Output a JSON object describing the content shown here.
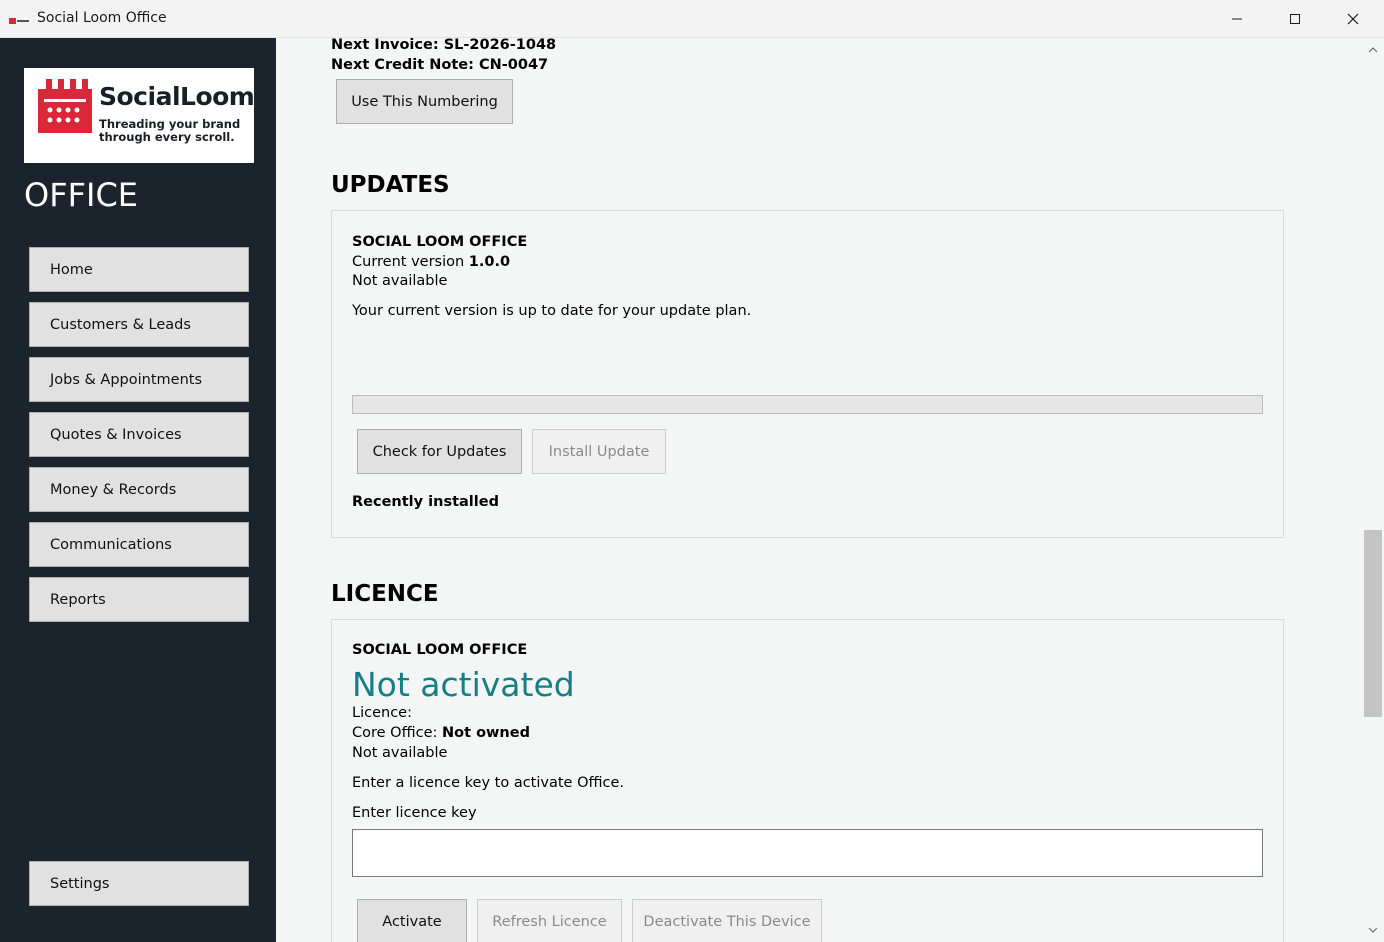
{
  "window": {
    "title": "Social Loom Office"
  },
  "sidebar": {
    "logo": {
      "name": "SocialLoom",
      "tagline": "Threading your brand through every scroll."
    },
    "section_label": "OFFICE",
    "nav": [
      {
        "label": "Home"
      },
      {
        "label": "Customers & Leads"
      },
      {
        "label": "Jobs & Appointments"
      },
      {
        "label": "Quotes & Invoices"
      },
      {
        "label": "Money & Records"
      },
      {
        "label": "Communications"
      },
      {
        "label": "Reports"
      }
    ],
    "settings_label": "Settings"
  },
  "numbering": {
    "next_invoice_label": "Next Invoice:",
    "next_invoice_value": "SL-2026-1048",
    "next_credit_label": "Next Credit Note:",
    "next_credit_value": "CN-0047",
    "use_button": "Use This Numbering"
  },
  "updates": {
    "heading": "UPDATES",
    "product": "SOCIAL LOOM OFFICE",
    "current_version_label": "Current version",
    "current_version_value": "1.0.0",
    "availability": "Not available",
    "message": "Your current version is up to date for your update plan.",
    "progress": 0,
    "check_button": "Check for Updates",
    "install_button": "Install Update",
    "recent_heading": "Recently installed"
  },
  "licence": {
    "heading": "LICENCE",
    "product": "SOCIAL LOOM OFFICE",
    "status": "Not activated",
    "licence_label": "Licence:",
    "core_label": "Core Office:",
    "core_value": "Not owned",
    "availability": "Not available",
    "instruction": "Enter a licence key to activate Office.",
    "key_label": "Enter licence key",
    "key_value": "",
    "activate_button": "Activate",
    "refresh_button": "Refresh Licence",
    "deactivate_button": "Deactivate This Device"
  },
  "colors": {
    "sidebar_bg": "#1b232c",
    "brand_red": "#d8283a",
    "status_teal": "#157f87"
  }
}
